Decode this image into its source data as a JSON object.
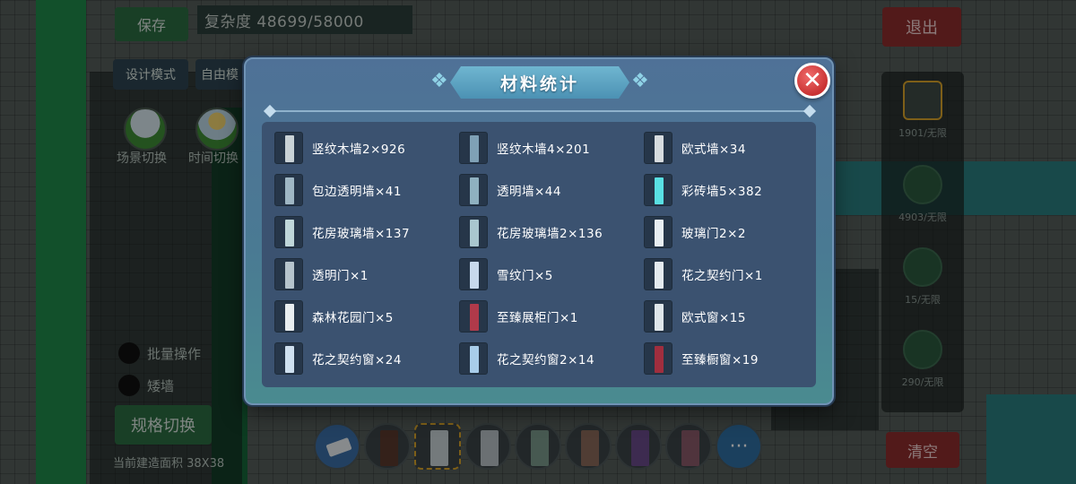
{
  "background": {
    "save_label": "保存",
    "complexity_label": "复杂度 48699/58000",
    "design_mode_label": "设计模式",
    "free_label": "自由模",
    "exit_label": "退出",
    "scene_switch_label": "场景切换",
    "time_switch_label": "时间切换",
    "batch_label": "批量操作",
    "short_wall_label": "矮墙",
    "spec_switch_label": "规格切换",
    "area_label": "当前建造面积 38X38",
    "clear_label": "清空",
    "right_panel": [
      {
        "label": "1901/无限"
      },
      {
        "label": "4903/无限"
      },
      {
        "label": "15/无限"
      },
      {
        "label": "290/无限"
      }
    ],
    "more_symbol": "···"
  },
  "modal": {
    "title": "材料统计",
    "close_symbol": "✕",
    "items": [
      {
        "label": "竖纹木墙2×926",
        "icon": "vertical-wood-wall-icon",
        "color": "#c9d2d6"
      },
      {
        "label": "竖纹木墙4×201",
        "icon": "vertical-wood-wall-icon",
        "color": "#7fa1b6"
      },
      {
        "label": "欧式墙×34",
        "icon": "european-wall-icon",
        "color": "#d7dcdf"
      },
      {
        "label": "包边透明墙×41",
        "icon": "edged-transparent-wall-icon",
        "color": "#9fb7c4"
      },
      {
        "label": "透明墙×44",
        "icon": "transparent-wall-icon",
        "color": "#8fb1c0"
      },
      {
        "label": "彩砖墙5×382",
        "icon": "colored-brick-wall-icon",
        "color": "#59e0e3"
      },
      {
        "label": "花房玻璃墙×137",
        "icon": "greenhouse-glass-wall-icon",
        "color": "#bfd6d9"
      },
      {
        "label": "花房玻璃墙2×136",
        "icon": "greenhouse-glass-wall-icon",
        "color": "#a9c7cf"
      },
      {
        "label": "玻璃门2×2",
        "icon": "glass-door-icon",
        "color": "#e8eef2"
      },
      {
        "label": "透明门×1",
        "icon": "transparent-door-icon",
        "color": "#b6c4cc"
      },
      {
        "label": "雪纹门×5",
        "icon": "snow-pattern-door-icon",
        "color": "#c7d9ec"
      },
      {
        "label": "花之契约门×1",
        "icon": "flower-contract-door-icon",
        "color": "#e4eaee"
      },
      {
        "label": "森林花园门×5",
        "icon": "forest-garden-door-icon",
        "color": "#e9eef0"
      },
      {
        "label": "至臻展柜门×1",
        "icon": "supreme-display-door-icon",
        "color": "#b03a4a"
      },
      {
        "label": "欧式窗×15",
        "icon": "european-window-icon",
        "color": "#dfe6ea"
      },
      {
        "label": "花之契约窗×24",
        "icon": "flower-contract-window-icon",
        "color": "#cfe0ef"
      },
      {
        "label": "花之契约窗2×14",
        "icon": "flower-contract-window-icon",
        "color": "#a8cdea"
      },
      {
        "label": "至臻橱窗×19",
        "icon": "supreme-showcase-window-icon",
        "color": "#a02e3e"
      }
    ]
  }
}
